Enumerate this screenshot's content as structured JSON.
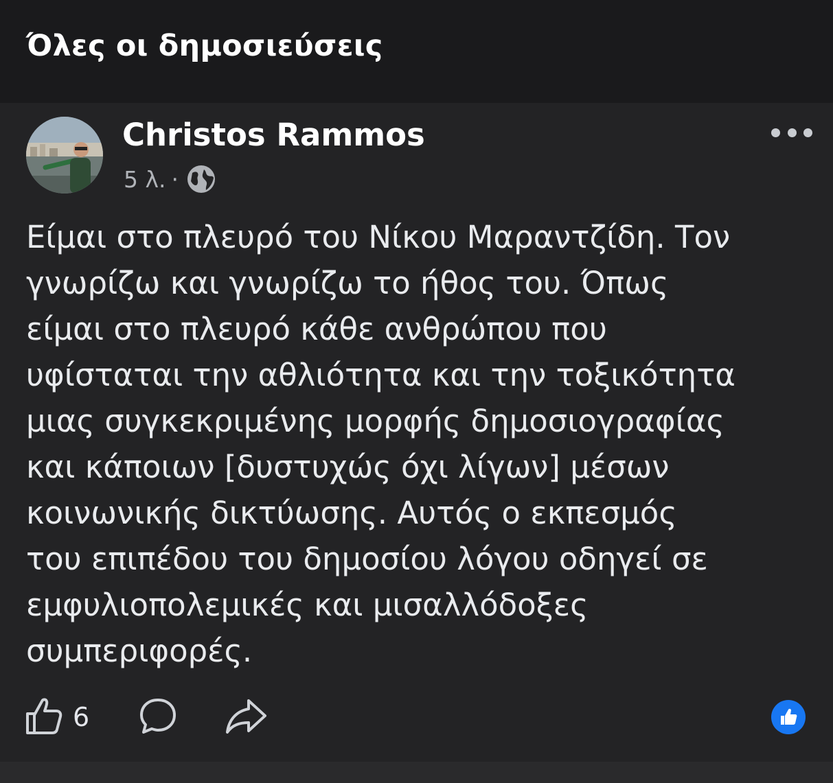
{
  "section_title": "Όλες οι δημοσιεύσεις",
  "post": {
    "author": "Christos Rammos",
    "time": "5 λ.",
    "separator": "·",
    "privacy_icon": "globe-icon",
    "more_icon": "more-options-icon",
    "text": "Είμαι στο πλευρό του Νίκου Μαραντζίδη. Τον\nγνωρίζω και γνωρίζω το ήθος του. Όπως\nείμαι στο πλευρό κάθε ανθρώπου που\nυφίσταται την αθλιότητα και την τοξικότητα\nμιας  συγκεκριμένης μορφής δημοσιογραφίας\nκαι κάποιων [δυστυχώς όχι λίγων] μέσων\nκοινωνικής δικτύωσης. Αυτός ο εκπεσμός\nτου επιπέδου του δημοσίου λόγου οδηγεί σε\nεμφυλιοπολεμικές και μισαλλόδοξες\nσυμπεριφορές.",
    "like_count": "6",
    "action_icons": [
      "like-icon",
      "comment-icon",
      "share-icon"
    ],
    "reaction_icon": "like-reaction-icon"
  },
  "colors": {
    "background": "#1a1a1c",
    "card": "#232325",
    "text": "#e9ebee",
    "secondary_text": "#b0b3b8",
    "accent": "#1877f2"
  }
}
